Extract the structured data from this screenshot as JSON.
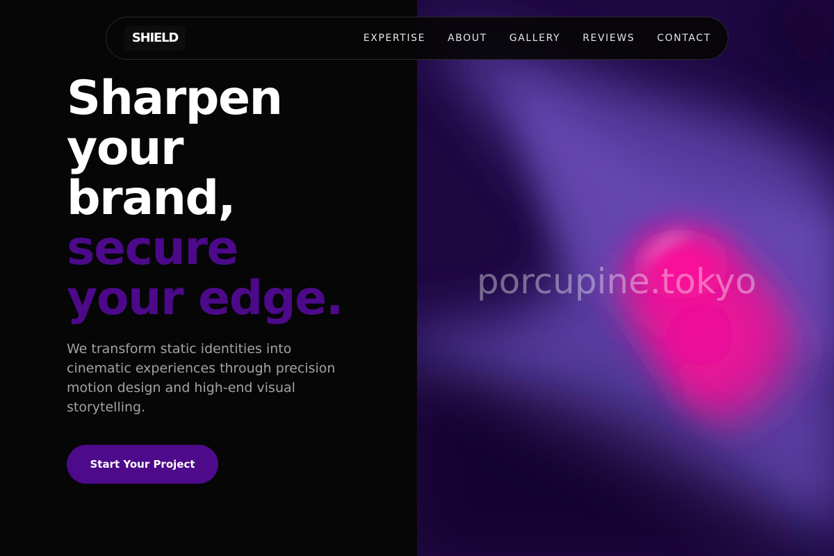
{
  "brand": {
    "logo_text": "SHIELD"
  },
  "nav": {
    "items": [
      {
        "label": "EXPERTISE"
      },
      {
        "label": "ABOUT"
      },
      {
        "label": "GALLERY"
      },
      {
        "label": "REVIEWS"
      },
      {
        "label": "CONTACT"
      }
    ]
  },
  "hero": {
    "headline_white": [
      "Sharpen",
      "your",
      "brand,"
    ],
    "headline_purple": [
      "secure",
      "your edge."
    ],
    "description": "We transform static identities into cinematic experiences through precision motion design and high-end visual storytelling.",
    "cta_label": "Start Your Project"
  },
  "visual": {
    "watermark": "porcupine.tokyo"
  },
  "colors": {
    "accent": "#4c0a8a",
    "background": "#060606",
    "gradient_pink": "#ff0a9a",
    "gradient_violet": "#5b3fa6"
  }
}
